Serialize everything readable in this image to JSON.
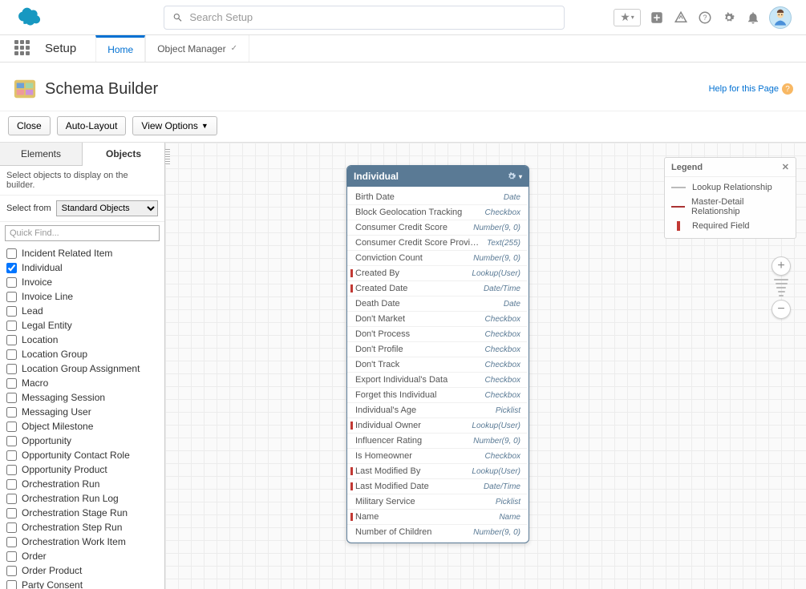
{
  "header": {
    "search_placeholder": "Search Setup"
  },
  "nav": {
    "app_title": "Setup",
    "tabs": [
      {
        "label": "Home",
        "active": true
      },
      {
        "label": "Object Manager",
        "active": false,
        "dropdown": true
      }
    ]
  },
  "page": {
    "title": "Schema Builder",
    "help_label": "Help for this Page"
  },
  "toolbar": {
    "close": "Close",
    "auto_layout": "Auto-Layout",
    "view_options": "View Options"
  },
  "sidebar": {
    "tabs": {
      "elements": "Elements",
      "objects": "Objects"
    },
    "desc": "Select objects to display on the builder.",
    "select_label": "Select from",
    "select_value": "Standard Objects",
    "quick_find_placeholder": "Quick Find...",
    "items": [
      {
        "label": "Incident Related Item",
        "checked": false
      },
      {
        "label": "Individual",
        "checked": true
      },
      {
        "label": "Invoice",
        "checked": false
      },
      {
        "label": "Invoice Line",
        "checked": false
      },
      {
        "label": "Lead",
        "checked": false
      },
      {
        "label": "Legal Entity",
        "checked": false
      },
      {
        "label": "Location",
        "checked": false
      },
      {
        "label": "Location Group",
        "checked": false
      },
      {
        "label": "Location Group Assignment",
        "checked": false
      },
      {
        "label": "Macro",
        "checked": false
      },
      {
        "label": "Messaging Session",
        "checked": false
      },
      {
        "label": "Messaging User",
        "checked": false
      },
      {
        "label": "Object Milestone",
        "checked": false
      },
      {
        "label": "Opportunity",
        "checked": false
      },
      {
        "label": "Opportunity Contact Role",
        "checked": false
      },
      {
        "label": "Opportunity Product",
        "checked": false
      },
      {
        "label": "Orchestration Run",
        "checked": false
      },
      {
        "label": "Orchestration Run Log",
        "checked": false
      },
      {
        "label": "Orchestration Stage Run",
        "checked": false
      },
      {
        "label": "Orchestration Step Run",
        "checked": false
      },
      {
        "label": "Orchestration Work Item",
        "checked": false
      },
      {
        "label": "Order",
        "checked": false
      },
      {
        "label": "Order Product",
        "checked": false
      },
      {
        "label": "Party Consent",
        "checked": false
      }
    ]
  },
  "object_card": {
    "title": "Individual",
    "fields": [
      {
        "name": "Birth Date",
        "type": "Date",
        "required": false
      },
      {
        "name": "Block Geolocation Tracking",
        "type": "Checkbox",
        "required": false
      },
      {
        "name": "Consumer Credit Score",
        "type": "Number(9, 0)",
        "required": false
      },
      {
        "name": "Consumer Credit Score Provider Name",
        "type": "Text(255)",
        "required": false
      },
      {
        "name": "Conviction Count",
        "type": "Number(9, 0)",
        "required": false
      },
      {
        "name": "Created By",
        "type": "Lookup(User)",
        "required": true
      },
      {
        "name": "Created Date",
        "type": "Date/Time",
        "required": true
      },
      {
        "name": "Death Date",
        "type": "Date",
        "required": false
      },
      {
        "name": "Don't Market",
        "type": "Checkbox",
        "required": false
      },
      {
        "name": "Don't Process",
        "type": "Checkbox",
        "required": false
      },
      {
        "name": "Don't Profile",
        "type": "Checkbox",
        "required": false
      },
      {
        "name": "Don't Track",
        "type": "Checkbox",
        "required": false
      },
      {
        "name": "Export Individual's Data",
        "type": "Checkbox",
        "required": false
      },
      {
        "name": "Forget this Individual",
        "type": "Checkbox",
        "required": false
      },
      {
        "name": "Individual's Age",
        "type": "Picklist",
        "required": false
      },
      {
        "name": "Individual Owner",
        "type": "Lookup(User)",
        "required": true
      },
      {
        "name": "Influencer Rating",
        "type": "Number(9, 0)",
        "required": false
      },
      {
        "name": "Is Homeowner",
        "type": "Checkbox",
        "required": false
      },
      {
        "name": "Last Modified By",
        "type": "Lookup(User)",
        "required": true
      },
      {
        "name": "Last Modified Date",
        "type": "Date/Time",
        "required": true
      },
      {
        "name": "Military Service",
        "type": "Picklist",
        "required": false
      },
      {
        "name": "Name",
        "type": "Name",
        "required": true
      },
      {
        "name": "Number of Children",
        "type": "Number(9, 0)",
        "required": false
      }
    ]
  },
  "legend": {
    "title": "Legend",
    "lookup": "Lookup Relationship",
    "master": "Master-Detail Relationship",
    "required": "Required Field"
  }
}
